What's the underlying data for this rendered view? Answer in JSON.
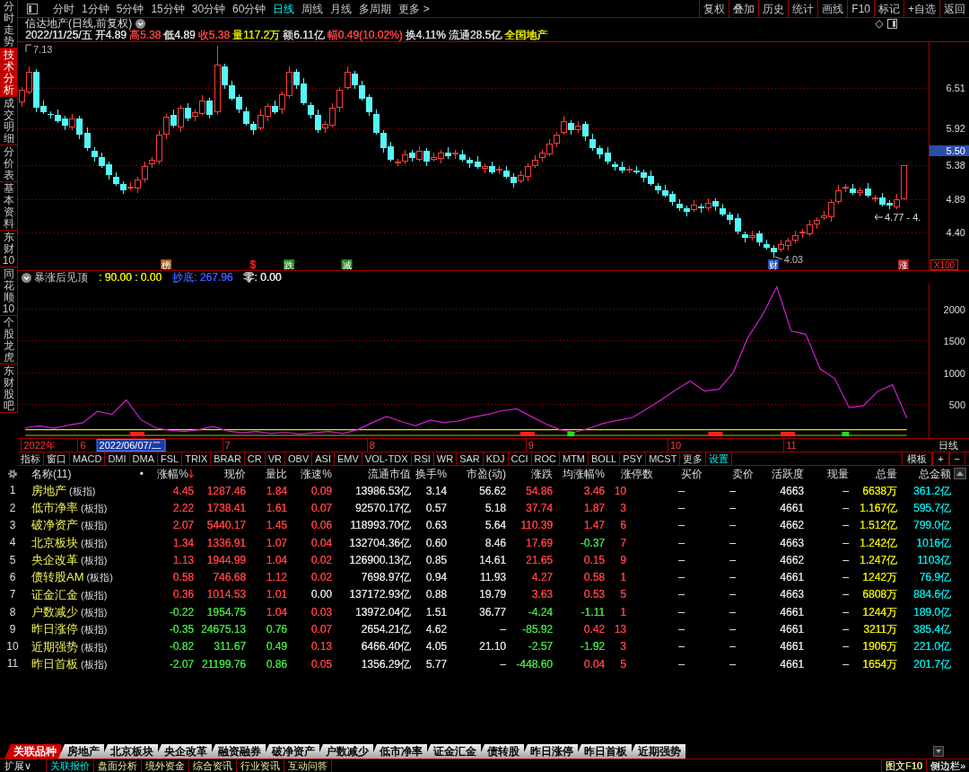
{
  "side_tabs": [
    {
      "label": "分时走势",
      "selected": false
    },
    {
      "label": "技术分析",
      "selected": true
    },
    {
      "label": "成交明细",
      "selected": false
    },
    {
      "label": "分价表",
      "selected": false
    },
    {
      "label": "基本资料",
      "selected": false
    },
    {
      "label": "东财10",
      "selected": false
    },
    {
      "label": "同花顺10",
      "selected": false
    },
    {
      "label": "个股龙虎",
      "selected": false
    },
    {
      "label": "东财股吧",
      "selected": false
    }
  ],
  "toolbar": {
    "periods": [
      {
        "label": "分时",
        "selected": false
      },
      {
        "label": "1分钟",
        "selected": false
      },
      {
        "label": "5分钟",
        "selected": false
      },
      {
        "label": "15分钟",
        "selected": false
      },
      {
        "label": "30分钟",
        "selected": false
      },
      {
        "label": "60分钟",
        "selected": false
      },
      {
        "label": "日线",
        "selected": true
      },
      {
        "label": "周线",
        "selected": false
      },
      {
        "label": "月线",
        "selected": false
      },
      {
        "label": "多周期",
        "selected": false
      }
    ],
    "more": "更多 >",
    "tools": [
      "复权",
      "叠加",
      "历史",
      "统计",
      "画线",
      "F10",
      "标记",
      "+自选",
      "返回"
    ]
  },
  "stock_header": {
    "title": "信达地产(日线,前复权)",
    "quote": [
      {
        "text": "2022/11/25/五",
        "color": "#dcdcdc"
      },
      {
        "text": "开4.89",
        "color": "#dcdcdc"
      },
      {
        "text": "高5.38",
        "color": "#ff4040"
      },
      {
        "text": "低4.89",
        "color": "#dcdcdc"
      },
      {
        "text": "收5.38",
        "color": "#ff4040"
      },
      {
        "text": "量117.2万",
        "color": "#e6e600"
      },
      {
        "text": "额6.11亿",
        "color": "#dcdcdc"
      },
      {
        "text": "幅0.49(10.02%)",
        "color": "#ff4040"
      },
      {
        "text": "换4.11%",
        "color": "#dcdcdc"
      },
      {
        "text": "流通28.5亿",
        "color": "#dcdcdc"
      },
      {
        "text": "全国地产",
        "color": "#e6e600"
      }
    ]
  },
  "price_chart": {
    "chart_data": {
      "type": "candlestick",
      "categories": [
        null,
        null,
        null,
        null,
        null,
        null,
        null,
        null,
        null,
        null,
        null,
        null,
        null,
        null,
        null,
        null,
        null,
        null,
        null,
        null,
        null,
        null,
        null,
        null,
        null,
        null,
        null,
        null,
        null,
        null,
        null,
        null,
        null,
        null,
        null,
        null,
        null,
        null,
        null,
        null,
        null,
        null,
        null,
        null,
        null,
        null,
        null,
        null,
        null,
        null,
        null,
        null,
        null,
        null,
        null,
        null,
        null,
        null,
        null,
        null,
        null,
        null,
        null,
        null,
        null,
        null,
        null,
        null,
        null,
        null,
        null,
        null,
        null,
        null,
        null,
        null,
        null,
        null,
        null,
        null,
        null,
        null,
        null,
        null,
        null,
        null,
        null,
        null,
        null,
        null,
        null,
        null,
        null,
        null,
        null,
        null,
        null,
        null,
        null,
        null,
        null,
        null,
        null,
        null,
        null,
        null,
        null,
        null,
        null,
        null,
        null,
        null,
        null,
        null,
        null,
        null,
        null,
        null,
        null,
        null,
        null,
        null,
        null,
        null,
        null,
        null
      ],
      "ohlc": [
        [
          6.3,
          6.52,
          6.24,
          6.48
        ],
        [
          6.45,
          6.82,
          6.42,
          6.75
        ],
        [
          6.75,
          6.79,
          6.16,
          6.22
        ],
        [
          6.25,
          6.32,
          6.13,
          6.16
        ],
        [
          6.13,
          6.17,
          6.06,
          6.12
        ],
        [
          6.12,
          6.19,
          6.0,
          6.03
        ],
        [
          6.06,
          6.1,
          5.9,
          5.96
        ],
        [
          5.93,
          6.13,
          5.9,
          6.06
        ],
        [
          6.06,
          6.1,
          5.77,
          5.83
        ],
        [
          5.86,
          5.93,
          5.6,
          5.63
        ],
        [
          5.6,
          5.64,
          5.44,
          5.5
        ],
        [
          5.5,
          5.57,
          5.34,
          5.37
        ],
        [
          5.4,
          5.44,
          5.18,
          5.24
        ],
        [
          5.21,
          5.28,
          5.08,
          5.11
        ],
        [
          5.11,
          5.15,
          4.96,
          5.02
        ],
        [
          5.05,
          5.14,
          5.02,
          5.07
        ],
        [
          5.04,
          5.21,
          4.98,
          5.17
        ],
        [
          5.17,
          5.44,
          5.14,
          5.37
        ],
        [
          5.4,
          5.5,
          5.34,
          5.46
        ],
        [
          5.43,
          5.9,
          5.4,
          5.83
        ],
        [
          5.83,
          6.13,
          5.77,
          6.09
        ],
        [
          6.12,
          6.19,
          5.93,
          5.96
        ],
        [
          5.93,
          6.26,
          5.87,
          6.22
        ],
        [
          6.22,
          6.29,
          6.03,
          6.06
        ],
        [
          6.09,
          6.2,
          6.03,
          6.16
        ],
        [
          6.13,
          6.4,
          6.1,
          6.33
        ],
        [
          6.33,
          6.37,
          6.06,
          6.12
        ],
        [
          6.15,
          7.13,
          6.12,
          6.85
        ],
        [
          6.82,
          6.86,
          6.49,
          6.55
        ],
        [
          6.55,
          6.62,
          6.32,
          6.35
        ],
        [
          6.38,
          6.42,
          6.14,
          6.2
        ],
        [
          6.17,
          6.24,
          5.96,
          5.99
        ],
        [
          5.99,
          6.03,
          5.83,
          5.89
        ],
        [
          5.92,
          6.19,
          5.89,
          6.12
        ],
        [
          6.09,
          6.29,
          6.03,
          6.25
        ],
        [
          6.25,
          6.32,
          6.13,
          6.16
        ],
        [
          6.19,
          6.46,
          6.13,
          6.42
        ],
        [
          6.39,
          6.82,
          6.36,
          6.75
        ],
        [
          6.75,
          6.79,
          6.49,
          6.55
        ],
        [
          6.58,
          6.65,
          6.26,
          6.29
        ],
        [
          6.26,
          6.3,
          6.06,
          6.12
        ],
        [
          6.12,
          6.19,
          5.86,
          5.89
        ],
        [
          5.92,
          6.03,
          5.86,
          5.99
        ],
        [
          5.96,
          6.29,
          5.93,
          6.22
        ],
        [
          6.22,
          6.52,
          6.16,
          6.48
        ],
        [
          6.51,
          6.82,
          6.48,
          6.75
        ],
        [
          6.72,
          6.76,
          6.49,
          6.55
        ],
        [
          6.55,
          6.62,
          6.32,
          6.35
        ],
        [
          6.38,
          6.42,
          6.1,
          6.16
        ],
        [
          6.13,
          6.2,
          5.83,
          5.86
        ],
        [
          5.86,
          5.9,
          5.57,
          5.63
        ],
        [
          5.66,
          5.73,
          5.43,
          5.46
        ],
        [
          5.43,
          5.47,
          5.37,
          5.43
        ],
        [
          5.43,
          5.61,
          5.4,
          5.54
        ],
        [
          5.57,
          5.61,
          5.43,
          5.49
        ],
        [
          5.46,
          5.66,
          5.43,
          5.59
        ],
        [
          5.59,
          5.63,
          5.37,
          5.43
        ],
        [
          5.46,
          5.57,
          5.43,
          5.5
        ],
        [
          5.47,
          5.61,
          5.41,
          5.57
        ],
        [
          5.57,
          5.64,
          5.48,
          5.51
        ],
        [
          5.54,
          5.61,
          5.48,
          5.57
        ],
        [
          5.54,
          5.61,
          5.43,
          5.46
        ],
        [
          5.46,
          5.5,
          5.35,
          5.41
        ],
        [
          5.44,
          5.51,
          5.33,
          5.36
        ],
        [
          5.33,
          5.41,
          5.27,
          5.37
        ],
        [
          5.37,
          5.44,
          5.25,
          5.28
        ],
        [
          5.31,
          5.37,
          5.25,
          5.33
        ],
        [
          5.3,
          5.37,
          5.19,
          5.22
        ],
        [
          5.22,
          5.26,
          5.06,
          5.12
        ],
        [
          5.15,
          5.31,
          5.12,
          5.24
        ],
        [
          5.21,
          5.41,
          5.15,
          5.37
        ],
        [
          5.37,
          5.53,
          5.34,
          5.46
        ],
        [
          5.49,
          5.61,
          5.43,
          5.57
        ],
        [
          5.54,
          5.77,
          5.51,
          5.7
        ],
        [
          5.7,
          5.87,
          5.64,
          5.83
        ],
        [
          5.86,
          6.1,
          5.83,
          6.03
        ],
        [
          6.0,
          6.04,
          5.83,
          5.89
        ],
        [
          5.89,
          6.03,
          5.86,
          5.96
        ],
        [
          5.99,
          6.03,
          5.74,
          5.8
        ],
        [
          5.77,
          5.84,
          5.6,
          5.63
        ],
        [
          5.63,
          5.67,
          5.48,
          5.54
        ],
        [
          5.57,
          5.64,
          5.4,
          5.43
        ],
        [
          5.4,
          5.44,
          5.3,
          5.36
        ],
        [
          5.36,
          5.43,
          5.27,
          5.3
        ],
        [
          5.33,
          5.37,
          5.27,
          5.33
        ],
        [
          5.3,
          5.37,
          5.25,
          5.28
        ],
        [
          5.28,
          5.32,
          5.14,
          5.2
        ],
        [
          5.23,
          5.3,
          5.08,
          5.11
        ],
        [
          5.08,
          5.12,
          4.96,
          5.02
        ],
        [
          5.02,
          5.09,
          4.91,
          4.94
        ],
        [
          4.97,
          5.01,
          4.79,
          4.85
        ],
        [
          4.82,
          4.89,
          4.72,
          4.75
        ],
        [
          4.75,
          4.79,
          4.64,
          4.7
        ],
        [
          4.73,
          4.88,
          4.7,
          4.81
        ],
        [
          4.78,
          4.82,
          4.69,
          4.75
        ],
        [
          4.75,
          4.9,
          4.72,
          4.83
        ],
        [
          4.86,
          4.9,
          4.72,
          4.78
        ],
        [
          4.75,
          4.82,
          4.64,
          4.67
        ],
        [
          4.67,
          4.71,
          4.52,
          4.58
        ],
        [
          4.61,
          4.68,
          4.38,
          4.41
        ],
        [
          4.38,
          4.42,
          4.26,
          4.32
        ],
        [
          4.32,
          4.43,
          4.29,
          4.36
        ],
        [
          4.39,
          4.43,
          4.2,
          4.26
        ],
        [
          4.23,
          4.3,
          4.15,
          4.18
        ],
        [
          4.18,
          4.22,
          4.03,
          4.12
        ],
        [
          4.15,
          4.3,
          4.12,
          4.23
        ],
        [
          4.2,
          4.32,
          4.14,
          4.28
        ],
        [
          4.28,
          4.43,
          4.25,
          4.36
        ],
        [
          4.39,
          4.45,
          4.33,
          4.41
        ],
        [
          4.38,
          4.59,
          4.35,
          4.52
        ],
        [
          4.52,
          4.62,
          4.46,
          4.58
        ],
        [
          4.61,
          4.72,
          4.58,
          4.65
        ],
        [
          4.62,
          4.89,
          4.56,
          4.85
        ],
        [
          4.85,
          5.09,
          4.82,
          5.02
        ],
        [
          5.05,
          5.11,
          4.99,
          5.07
        ],
        [
          5.04,
          5.11,
          4.95,
          4.98
        ],
        [
          4.98,
          5.06,
          4.92,
          5.02
        ],
        [
          5.05,
          5.12,
          4.91,
          4.94
        ],
        [
          4.91,
          4.95,
          4.85,
          4.91
        ],
        [
          4.91,
          4.98,
          4.78,
          4.81
        ],
        [
          4.84,
          4.88,
          4.74,
          4.8
        ],
        [
          4.77,
          4.96,
          4.74,
          4.89
        ],
        [
          4.89,
          5.38,
          4.89,
          5.38
        ],
        null,
        null,
        null
      ],
      "ylim": [
        3.84,
        7.19
      ],
      "yticks": [
        {
          "value": 4.4,
          "label": "4.40"
        },
        {
          "value": 4.89,
          "label": "4.89"
        },
        {
          "value": 5.38,
          "label": "5.38"
        },
        {
          "value": 5.92,
          "label": "5.92"
        },
        {
          "value": 6.51,
          "label": "6.51"
        }
      ],
      "grid": true
    },
    "cursor_price": "5.50",
    "scale": "X100",
    "high_label": "7.13",
    "low_label": "4.03",
    "last_label": "4.77 - 4.",
    "markers": [
      {
        "text": "榜",
        "kind": "tag",
        "color": "#a0602a"
      },
      {
        "text": "$",
        "kind": "plain",
        "color": "#ff2020"
      },
      {
        "text": "跌",
        "kind": "tag",
        "color": "#2a8a2a"
      },
      {
        "text": "减",
        "kind": "tag",
        "color": "#2a8a2a"
      },
      {
        "text": "财",
        "kind": "tag",
        "color": "#2a50b0"
      },
      {
        "text": "涨",
        "kind": "tag",
        "color": "#a02020"
      }
    ]
  },
  "indicator": {
    "name": "暴涨后见顶",
    "readings": [
      {
        "text": ": 90.00 : 0.00",
        "color": "#e6e600"
      },
      {
        "text": "抄底: 267.96",
        "color": "#3a5aff"
      },
      {
        "text": "零: 0.00",
        "color": "#e6e6e6"
      }
    ],
    "chart_data": {
      "type": "line",
      "categories": [
        null,
        "2022年",
        null,
        null,
        "6",
        null,
        null,
        null,
        null,
        null,
        null,
        null,
        null,
        null,
        "7",
        null,
        null,
        null,
        null,
        null,
        null,
        null,
        null,
        null,
        "8",
        null,
        null,
        null,
        null,
        null,
        null,
        null,
        null,
        null,
        null,
        "9",
        null,
        null,
        null,
        null,
        null,
        null,
        null,
        null,
        null,
        "10",
        null,
        null,
        null,
        null,
        null,
        null,
        null,
        "11",
        null,
        null,
        null,
        null,
        null,
        null,
        null,
        null,
        null
      ],
      "ylim": [
        -43,
        2400
      ],
      "yticks": [
        500,
        1000,
        1500,
        2000
      ],
      "grid": true,
      "series": [
        {
          "color": "#e6e600",
          "values": [
            90,
            90,
            90,
            90,
            90,
            90,
            90,
            90,
            90,
            90,
            90,
            90,
            90,
            90,
            90,
            90,
            90,
            90,
            90,
            90,
            90,
            90,
            90,
            90,
            90,
            90,
            90,
            90,
            90,
            90,
            90,
            90,
            90,
            90,
            90,
            90,
            90,
            90,
            90,
            90,
            90,
            90,
            90,
            90,
            90,
            90,
            90,
            90,
            90,
            90,
            90,
            90,
            90,
            90,
            90,
            90,
            90,
            90,
            90,
            90,
            90,
            90,
            null
          ]
        },
        {
          "color": "#b4b400",
          "values": [
            0,
            0,
            0,
            0,
            0,
            0,
            0,
            0,
            0,
            0,
            0,
            0,
            0,
            0,
            0,
            0,
            0,
            0,
            0,
            0,
            0,
            0,
            0,
            0,
            0,
            0,
            0,
            0,
            0,
            0,
            0,
            0,
            0,
            0,
            0,
            0,
            0,
            0,
            0,
            0,
            0,
            0,
            0,
            0,
            0,
            0,
            0,
            0,
            0,
            0,
            0,
            0,
            0,
            0,
            0,
            0,
            0,
            0,
            0,
            0,
            0,
            0,
            null
          ]
        },
        {
          "color": "#d020d0",
          "values": [
            120,
            150,
            110,
            160,
            200,
            380,
            330,
            560,
            250,
            120,
            80,
            60,
            90,
            140,
            70,
            40,
            60,
            30,
            50,
            20,
            40,
            60,
            30,
            90,
            200,
            300,
            220,
            150,
            240,
            200,
            230,
            290,
            330,
            390,
            420,
            300,
            180,
            90,
            50,
            110,
            190,
            240,
            280,
            420,
            560,
            720,
            860,
            700,
            730,
            1000,
            1550,
            1900,
            2350,
            1650,
            1600,
            1050,
            900,
            440,
            470,
            700,
            800,
            270,
            null
          ]
        }
      ]
    }
  },
  "date_axis": {
    "cursor": "2022/06/07/二",
    "period": "日线"
  },
  "indicator_tabs": {
    "items": [
      {
        "label": "指标",
        "selected": false
      },
      {
        "label": "窗口",
        "selected": false
      },
      {
        "label": "MACD",
        "selected": false
      },
      {
        "label": "DMI",
        "selected": false
      },
      {
        "label": "DMA",
        "selected": false
      },
      {
        "label": "FSL",
        "selected": false
      },
      {
        "label": "TRIX",
        "selected": false
      },
      {
        "label": "BRAR",
        "selected": false
      },
      {
        "label": "CR",
        "selected": false
      },
      {
        "label": "VR",
        "selected": false
      },
      {
        "label": "OBV",
        "selected": false
      },
      {
        "label": "ASI",
        "selected": false
      },
      {
        "label": "EMV",
        "selected": false
      },
      {
        "label": "VOL-TDX",
        "selected": false
      },
      {
        "label": "RSI",
        "selected": false
      },
      {
        "label": "WR",
        "selected": false
      },
      {
        "label": "SAR",
        "selected": false
      },
      {
        "label": "KDJ",
        "selected": false
      },
      {
        "label": "CCI",
        "selected": false
      },
      {
        "label": "ROC",
        "selected": false
      },
      {
        "label": "MTM",
        "selected": false
      },
      {
        "label": "BOLL",
        "selected": false
      },
      {
        "label": "PSY",
        "selected": false
      },
      {
        "label": "MCST",
        "selected": false
      },
      {
        "label": "更多",
        "selected": false
      },
      {
        "label": "设置",
        "selected": true
      }
    ],
    "right": [
      "模板",
      "+",
      "−"
    ]
  },
  "table": {
    "name_header": "名称(11)",
    "marker": "•",
    "columns": [
      {
        "label": "涨幅%",
        "sorted": true
      },
      {
        "label": "现价",
        "sorted": false
      },
      {
        "label": "量比",
        "sorted": false
      },
      {
        "label": "涨速%",
        "sorted": false
      },
      {
        "label": "流通市值",
        "sorted": false
      },
      {
        "label": "换手%",
        "sorted": false
      },
      {
        "label": "市盈(动)",
        "sorted": false
      },
      {
        "label": "涨跌",
        "sorted": false
      },
      {
        "label": "均涨幅%",
        "sorted": false
      },
      {
        "label": "涨停数",
        "sorted": false
      },
      {
        "label": "买价",
        "sorted": false
      },
      {
        "label": "卖价",
        "sorted": false
      },
      {
        "label": "活跃度",
        "sorted": false
      },
      {
        "label": "现量",
        "sorted": false
      },
      {
        "label": "总量",
        "sorted": false
      },
      {
        "label": "总金额",
        "sorted": false
      }
    ],
    "rows": [
      {
        "number": "1",
        "name": "房地产",
        "tag": "(板指)",
        "cells": [
          {
            "text": "4.45",
            "color": "#ff4040"
          },
          {
            "text": "1287.46",
            "color": "#ff4040"
          },
          {
            "text": "1.84",
            "color": "#ff4040"
          },
          {
            "text": "0.09",
            "color": "#ff4040"
          },
          {
            "text": "13986.53亿"
          },
          {
            "text": "3.14"
          },
          {
            "text": "56.62"
          },
          {
            "text": "54.86",
            "color": "#ff4040"
          },
          {
            "text": "3.46",
            "color": "#ff4040"
          },
          {
            "text": "10",
            "color": "#ff4040"
          },
          {
            "text": "–"
          },
          {
            "text": "–"
          },
          {
            "text": "4663"
          },
          {
            "text": "–"
          },
          {
            "text": "6638万",
            "color": "#e6e600"
          },
          {
            "text": "361.2亿",
            "color": "#00e0e0"
          }
        ]
      },
      {
        "number": "2",
        "name": "低市净率",
        "tag": "(板指)",
        "cells": [
          {
            "text": "2.22",
            "color": "#ff4040"
          },
          {
            "text": "1738.41",
            "color": "#ff4040"
          },
          {
            "text": "1.61",
            "color": "#ff4040"
          },
          {
            "text": "0.07",
            "color": "#ff4040"
          },
          {
            "text": "92570.17亿"
          },
          {
            "text": "0.57"
          },
          {
            "text": "5.18"
          },
          {
            "text": "37.74",
            "color": "#ff4040"
          },
          {
            "text": "1.87",
            "color": "#ff4040"
          },
          {
            "text": "3",
            "color": "#ff4040"
          },
          {
            "text": "–"
          },
          {
            "text": "–"
          },
          {
            "text": "4661"
          },
          {
            "text": "–"
          },
          {
            "text": "1.167亿",
            "color": "#e6e600"
          },
          {
            "text": "595.7亿",
            "color": "#00e0e0"
          }
        ]
      },
      {
        "number": "3",
        "name": "破净资产",
        "tag": "(板指)",
        "cells": [
          {
            "text": "2.07",
            "color": "#ff4040"
          },
          {
            "text": "5440.17",
            "color": "#ff4040"
          },
          {
            "text": "1.45",
            "color": "#ff4040"
          },
          {
            "text": "0.06",
            "color": "#ff4040"
          },
          {
            "text": "118993.70亿"
          },
          {
            "text": "0.63"
          },
          {
            "text": "5.64"
          },
          {
            "text": "110.39",
            "color": "#ff4040"
          },
          {
            "text": "1.47",
            "color": "#ff4040"
          },
          {
            "text": "6",
            "color": "#ff4040"
          },
          {
            "text": "–"
          },
          {
            "text": "–"
          },
          {
            "text": "4662"
          },
          {
            "text": "–"
          },
          {
            "text": "1.512亿",
            "color": "#e6e600"
          },
          {
            "text": "799.0亿",
            "color": "#00e0e0"
          }
        ]
      },
      {
        "number": "4",
        "name": "北京板块",
        "tag": "(板指)",
        "cells": [
          {
            "text": "1.34",
            "color": "#ff4040"
          },
          {
            "text": "1336.91",
            "color": "#ff4040"
          },
          {
            "text": "1.07",
            "color": "#ff4040"
          },
          {
            "text": "0.04",
            "color": "#ff4040"
          },
          {
            "text": "132704.36亿"
          },
          {
            "text": "0.60"
          },
          {
            "text": "8.46"
          },
          {
            "text": "17.69",
            "color": "#ff4040"
          },
          {
            "text": "-0.37",
            "color": "#40e040"
          },
          {
            "text": "7",
            "color": "#ff4040"
          },
          {
            "text": "–"
          },
          {
            "text": "–"
          },
          {
            "text": "4663"
          },
          {
            "text": "–"
          },
          {
            "text": "1.242亿",
            "color": "#e6e600"
          },
          {
            "text": "1016亿",
            "color": "#00e0e0"
          }
        ]
      },
      {
        "number": "5",
        "name": "央企改革",
        "tag": "(板指)",
        "cells": [
          {
            "text": "1.13",
            "color": "#ff4040"
          },
          {
            "text": "1944.99",
            "color": "#ff4040"
          },
          {
            "text": "1.04",
            "color": "#ff4040"
          },
          {
            "text": "0.02",
            "color": "#ff4040"
          },
          {
            "text": "126900.13亿"
          },
          {
            "text": "0.85"
          },
          {
            "text": "14.61"
          },
          {
            "text": "21.65",
            "color": "#ff4040"
          },
          {
            "text": "0.15",
            "color": "#ff4040"
          },
          {
            "text": "9",
            "color": "#ff4040"
          },
          {
            "text": "–"
          },
          {
            "text": "–"
          },
          {
            "text": "4662"
          },
          {
            "text": "–"
          },
          {
            "text": "1.247亿",
            "color": "#e6e600"
          },
          {
            "text": "1103亿",
            "color": "#00e0e0"
          }
        ]
      },
      {
        "number": "6",
        "name": "债转股AM",
        "tag": "(板指)",
        "cells": [
          {
            "text": "0.58",
            "color": "#ff4040"
          },
          {
            "text": "746.68",
            "color": "#ff4040"
          },
          {
            "text": "1.12",
            "color": "#ff4040"
          },
          {
            "text": "0.02",
            "color": "#ff4040"
          },
          {
            "text": "7698.97亿"
          },
          {
            "text": "0.94"
          },
          {
            "text": "11.93"
          },
          {
            "text": "4.27",
            "color": "#ff4040"
          },
          {
            "text": "0.58",
            "color": "#ff4040"
          },
          {
            "text": "1",
            "color": "#ff4040"
          },
          {
            "text": "–"
          },
          {
            "text": "–"
          },
          {
            "text": "4661"
          },
          {
            "text": "–"
          },
          {
            "text": "1242万",
            "color": "#e6e600"
          },
          {
            "text": "76.9亿",
            "color": "#00e0e0"
          }
        ]
      },
      {
        "number": "7",
        "name": "证金汇金",
        "tag": "(板指)",
        "cells": [
          {
            "text": "0.36",
            "color": "#ff4040"
          },
          {
            "text": "1014.53",
            "color": "#ff4040"
          },
          {
            "text": "1.01",
            "color": "#ff4040"
          },
          {
            "text": "0.00"
          },
          {
            "text": "137172.93亿"
          },
          {
            "text": "0.88"
          },
          {
            "text": "19.79"
          },
          {
            "text": "3.63",
            "color": "#ff4040"
          },
          {
            "text": "0.53",
            "color": "#ff4040"
          },
          {
            "text": "5",
            "color": "#ff4040"
          },
          {
            "text": "–"
          },
          {
            "text": "–"
          },
          {
            "text": "4663"
          },
          {
            "text": "–"
          },
          {
            "text": "6808万",
            "color": "#e6e600"
          },
          {
            "text": "884.6亿",
            "color": "#00e0e0"
          }
        ]
      },
      {
        "number": "8",
        "name": "户数减少",
        "tag": "(板指)",
        "cells": [
          {
            "text": "-0.22",
            "color": "#40e040"
          },
          {
            "text": "1954.75",
            "color": "#40e040"
          },
          {
            "text": "1.04",
            "color": "#ff4040"
          },
          {
            "text": "0.03",
            "color": "#ff4040"
          },
          {
            "text": "13972.04亿"
          },
          {
            "text": "1.51"
          },
          {
            "text": "36.77"
          },
          {
            "text": "-4.24",
            "color": "#40e040"
          },
          {
            "text": "-1.11",
            "color": "#40e040"
          },
          {
            "text": "1",
            "color": "#ff4040"
          },
          {
            "text": "–"
          },
          {
            "text": "–"
          },
          {
            "text": "4661"
          },
          {
            "text": "–"
          },
          {
            "text": "1244万",
            "color": "#e6e600"
          },
          {
            "text": "189.0亿",
            "color": "#00e0e0"
          }
        ]
      },
      {
        "number": "9",
        "name": "昨日涨停",
        "tag": "(板指)",
        "cells": [
          {
            "text": "-0.35",
            "color": "#40e040"
          },
          {
            "text": "24675.13",
            "color": "#40e040"
          },
          {
            "text": "0.76",
            "color": "#40e040"
          },
          {
            "text": "0.07",
            "color": "#ff4040"
          },
          {
            "text": "2654.21亿"
          },
          {
            "text": "4.62"
          },
          {
            "text": "–"
          },
          {
            "text": "-85.92",
            "color": "#40e040"
          },
          {
            "text": "0.42",
            "color": "#ff4040"
          },
          {
            "text": "13",
            "color": "#ff4040"
          },
          {
            "text": "–"
          },
          {
            "text": "–"
          },
          {
            "text": "4661"
          },
          {
            "text": "–"
          },
          {
            "text": "3211万",
            "color": "#e6e600"
          },
          {
            "text": "385.4亿",
            "color": "#00e0e0"
          }
        ]
      },
      {
        "number": "10",
        "name": "近期强势",
        "tag": "(板指)",
        "cells": [
          {
            "text": "-0.82",
            "color": "#40e040"
          },
          {
            "text": "311.67",
            "color": "#40e040"
          },
          {
            "text": "0.49",
            "color": "#40e040"
          },
          {
            "text": "0.13",
            "color": "#ff4040"
          },
          {
            "text": "6466.40亿"
          },
          {
            "text": "4.05"
          },
          {
            "text": "21.10"
          },
          {
            "text": "-2.57",
            "color": "#40e040"
          },
          {
            "text": "-1.92",
            "color": "#40e040"
          },
          {
            "text": "3",
            "color": "#ff4040"
          },
          {
            "text": "–"
          },
          {
            "text": "–"
          },
          {
            "text": "4661"
          },
          {
            "text": "–"
          },
          {
            "text": "1906万",
            "color": "#e6e600"
          },
          {
            "text": "221.0亿",
            "color": "#00e0e0"
          }
        ]
      },
      {
        "number": "11",
        "name": "昨日首板",
        "tag": "(板指)",
        "cells": [
          {
            "text": "-2.07",
            "color": "#40e040"
          },
          {
            "text": "21199.76",
            "color": "#40e040"
          },
          {
            "text": "0.86",
            "color": "#40e040"
          },
          {
            "text": "0.05",
            "color": "#ff4040"
          },
          {
            "text": "1356.29亿"
          },
          {
            "text": "5.77"
          },
          {
            "text": "–"
          },
          {
            "text": "-448.60",
            "color": "#40e040"
          },
          {
            "text": "0.04",
            "color": "#ff4040"
          },
          {
            "text": "5",
            "color": "#ff4040"
          },
          {
            "text": "–"
          },
          {
            "text": "–"
          },
          {
            "text": "4661"
          },
          {
            "text": "–"
          },
          {
            "text": "1654万",
            "color": "#e6e600"
          },
          {
            "text": "201.7亿",
            "color": "#00e0e0"
          }
        ]
      }
    ]
  },
  "bottom_tabs": {
    "items": [
      {
        "label": "关联品种",
        "selected": true
      },
      {
        "label": "房地产",
        "selected": false
      },
      {
        "label": "北京板块",
        "selected": false
      },
      {
        "label": "央企改革",
        "selected": false
      },
      {
        "label": "融资融券",
        "selected": false
      },
      {
        "label": "破净资产",
        "selected": false
      },
      {
        "label": "户数减少",
        "selected": false
      },
      {
        "label": "低市净率",
        "selected": false
      },
      {
        "label": "证金汇金",
        "selected": false
      },
      {
        "label": "债转股",
        "selected": false
      },
      {
        "label": "昨日涨停",
        "selected": false
      },
      {
        "label": "昨日首板",
        "selected": false
      },
      {
        "label": "近期强势",
        "selected": false
      }
    ]
  },
  "bottom_bar": {
    "items": [
      {
        "label": "扩展∨",
        "kind": "menu",
        "selected": false
      },
      {
        "label": "关联报价",
        "kind": "tab",
        "selected": true
      },
      {
        "label": "盘面分析",
        "kind": "tab",
        "selected": false
      },
      {
        "label": "境外资金",
        "kind": "tab",
        "selected": false
      },
      {
        "label": "综合资讯",
        "kind": "tab",
        "selected": false
      },
      {
        "label": "行业资讯",
        "kind": "tab",
        "selected": false
      },
      {
        "label": "互动问答",
        "kind": "tab",
        "selected": false
      }
    ],
    "right": [
      {
        "label": "图文F10",
        "color": "#e6e68c"
      },
      {
        "label": "侧边栏»",
        "color": "#dcdcdc"
      }
    ]
  }
}
